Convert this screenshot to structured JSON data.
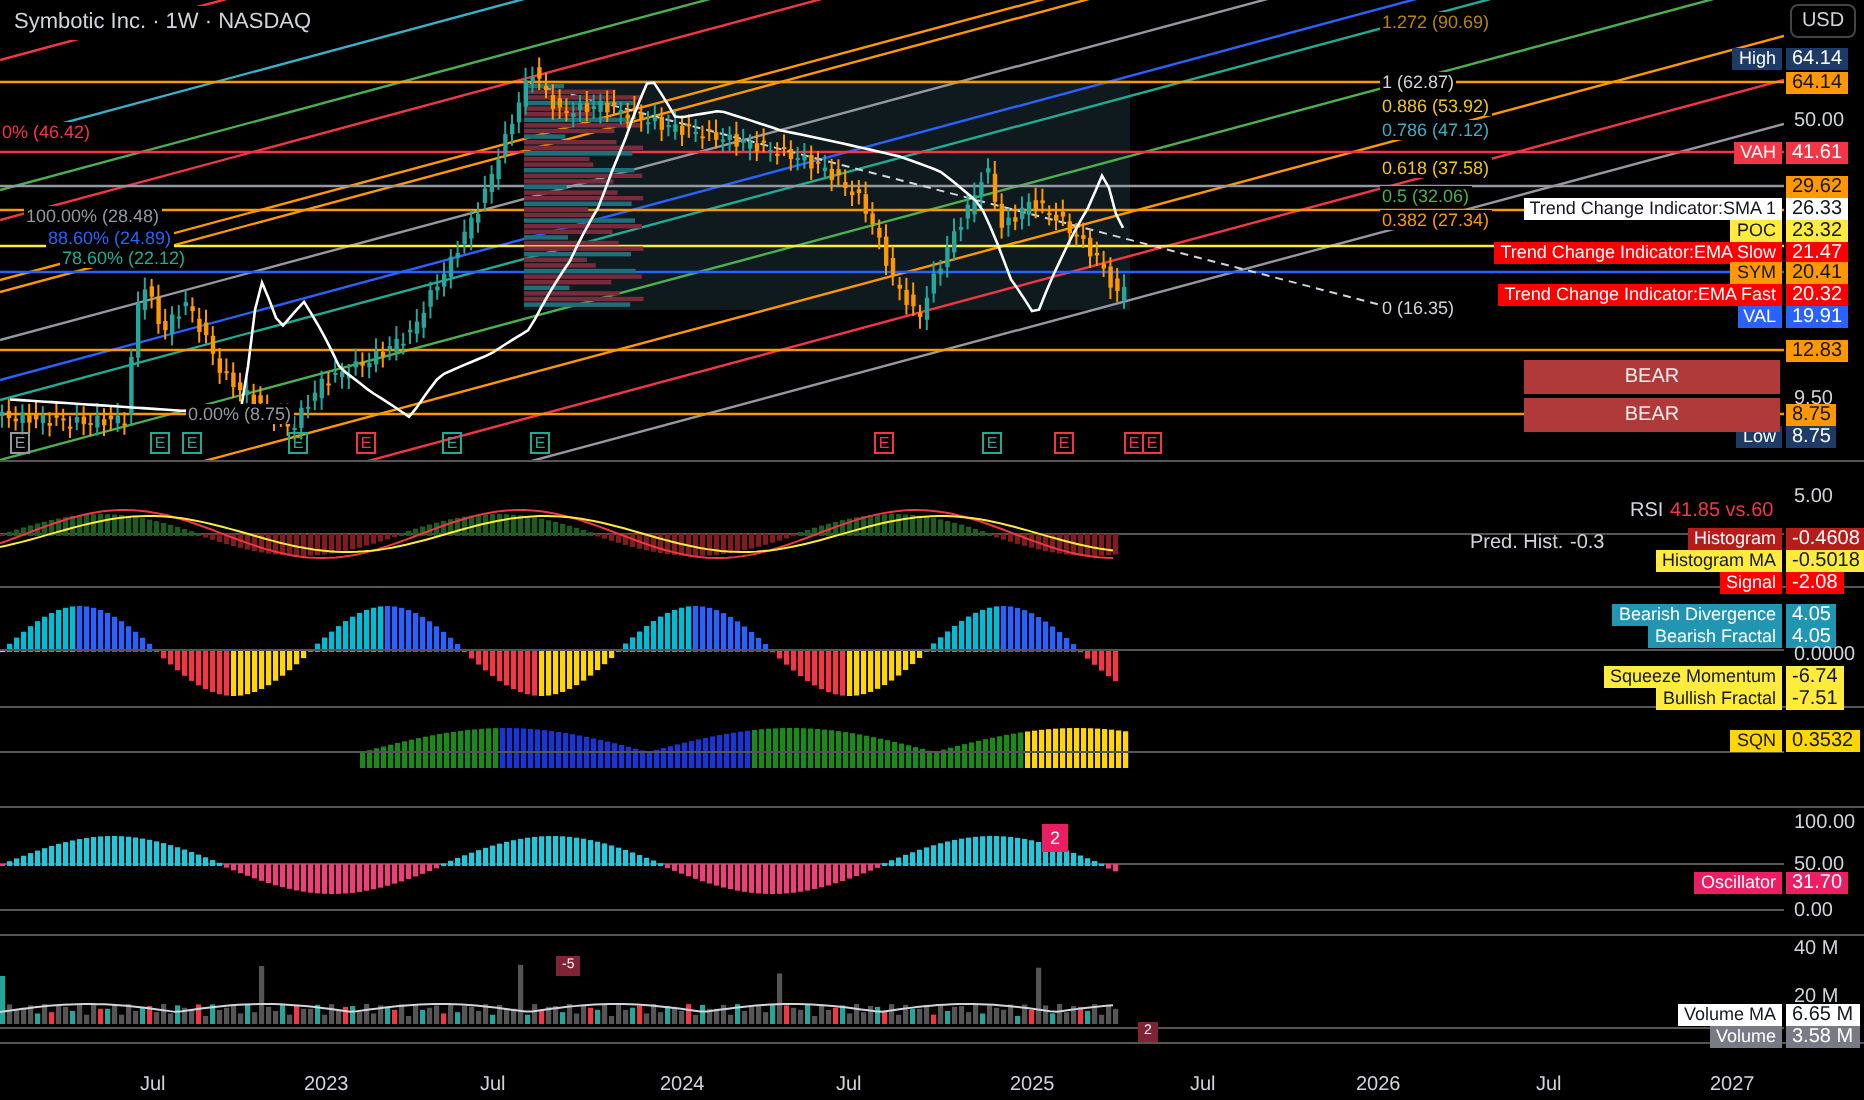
{
  "header": {
    "title": "Symbotic Inc. · 1W · NASDAQ",
    "currency": "USD"
  },
  "main_pane": {
    "left_fib_labels": [
      {
        "text": "0% (46.42)",
        "color": "#f23645"
      },
      {
        "text": "100.00% (28.48)",
        "color": "#9598a1"
      },
      {
        "text": "88.60% (24.89)",
        "color": "#2962ff"
      },
      {
        "text": "78.60% (22.12)",
        "color": "#22ab94"
      },
      {
        "text": "0.00% (8.75)",
        "color": "#9598a1"
      }
    ],
    "right_fib_labels": [
      {
        "text": "1.272 (90.69)",
        "color": "#b8860b"
      },
      {
        "text": "1 (62.87)",
        "color": "#d1d4dc"
      },
      {
        "text": "0.886 (53.92)",
        "color": "#f5c518"
      },
      {
        "text": "0.786 (47.12)",
        "color": "#3ab0c8"
      },
      {
        "text": "0.618 (37.58)",
        "color": "#f5c518"
      },
      {
        "text": "0.5 (32.06)",
        "color": "#4caf50"
      },
      {
        "text": "0.382 (27.34)",
        "color": "#ff9800"
      },
      {
        "text": "0 (16.35)",
        "color": "#d1d4dc"
      }
    ],
    "axis_ticks": [
      "50.00",
      "9.50"
    ],
    "price_tags": [
      {
        "label": "High",
        "value": "64.14",
        "color": "#1e3a66"
      },
      {
        "value": "64.14",
        "color": "#ff9800"
      },
      {
        "label": "VAH",
        "value": "41.61",
        "color": "#f23645"
      },
      {
        "value": "29.62",
        "color": "#ff9800"
      },
      {
        "label": "Trend Change Indicator:SMA 1",
        "value": "26.33",
        "color": "#ffffff"
      },
      {
        "label": "POC",
        "value": "23.32",
        "color": "#ffeb3b"
      },
      {
        "label": "Trend Change Indicator:EMA Slow",
        "value": "21.47",
        "color": "#ff0000"
      },
      {
        "label": "SYM",
        "value": "20.41",
        "color": "#ff9800"
      },
      {
        "label": "Trend Change Indicator:EMA Fast",
        "value": "20.32",
        "color": "#ff0000"
      },
      {
        "label": "VAL",
        "value": "19.91",
        "color": "#2962ff"
      },
      {
        "value": "12.83",
        "color": "#ff9800"
      },
      {
        "value": "8.75",
        "color": "#ff9800"
      },
      {
        "label": "Low",
        "value": "8.75",
        "color": "#1e3a66"
      }
    ],
    "signal_boxes": [
      "BEAR",
      "BEAR"
    ],
    "earnings_markers": [
      {
        "text": "E",
        "kind": "neutral"
      },
      {
        "text": "E",
        "kind": "positive"
      },
      {
        "text": "E",
        "kind": "positive"
      },
      {
        "text": "E",
        "kind": "positive"
      },
      {
        "text": "E",
        "kind": "negative"
      },
      {
        "text": "E",
        "kind": "positive"
      },
      {
        "text": "E",
        "kind": "positive"
      },
      {
        "text": "E",
        "kind": "negative"
      },
      {
        "text": "E",
        "kind": "positive"
      },
      {
        "text": "E",
        "kind": "negative"
      },
      {
        "text": "E",
        "kind": "negative"
      },
      {
        "text": "E",
        "kind": "negative"
      }
    ]
  },
  "rsi_pane": {
    "axis_ticks": [
      "5.00"
    ],
    "rsi_label": "RSI",
    "rsi_value": "41.85 vs.60",
    "pred_label": "Pred. Hist.",
    "pred_value": "-0.3",
    "tags": [
      {
        "label": "Histogram",
        "value": "-0.4608",
        "color": "#b71c1c"
      },
      {
        "label": "Histogram MA",
        "value": "-0.5018",
        "color": "#ffeb3b"
      },
      {
        "label": "Signal",
        "value": "-2.08",
        "color": "#ff0000"
      }
    ]
  },
  "squeeze_pane": {
    "axis_ticks": [
      "0.0000"
    ],
    "tags": [
      {
        "label": "Bearish Divergence",
        "value": "4.05",
        "color": "#2196b3"
      },
      {
        "label": "Bearish Fractal",
        "value": "4.05",
        "color": "#2196b3"
      },
      {
        "label": "Squeeze Momentum",
        "value": "-6.74",
        "color": "#ffeb3b"
      },
      {
        "label": "Bullish Fractal",
        "value": "-7.51",
        "color": "#ffeb3b"
      }
    ]
  },
  "sqn_pane": {
    "tags": [
      {
        "label": "SQN",
        "value": "0.3532",
        "color": "#ffd600"
      }
    ]
  },
  "oscillator_pane": {
    "axis_ticks": [
      "100.00",
      "50.00",
      "0.00"
    ],
    "marker": "2",
    "tags": [
      {
        "label": "Oscillator",
        "value": "31.70",
        "color": "#e91e63"
      }
    ]
  },
  "volume_pane": {
    "axis_ticks": [
      "40 M",
      "20 M"
    ],
    "markers": [
      "-5",
      "2"
    ],
    "tags": [
      {
        "label": "Volume MA",
        "value": "6.65 M",
        "color": "#ffffff"
      },
      {
        "label": "Volume",
        "value": "3.58 M",
        "color": "#787b86"
      }
    ]
  },
  "time_axis": [
    "Jul",
    "2023",
    "Jul",
    "2024",
    "Jul",
    "2025",
    "Jul",
    "2026",
    "Jul",
    "2027"
  ]
}
